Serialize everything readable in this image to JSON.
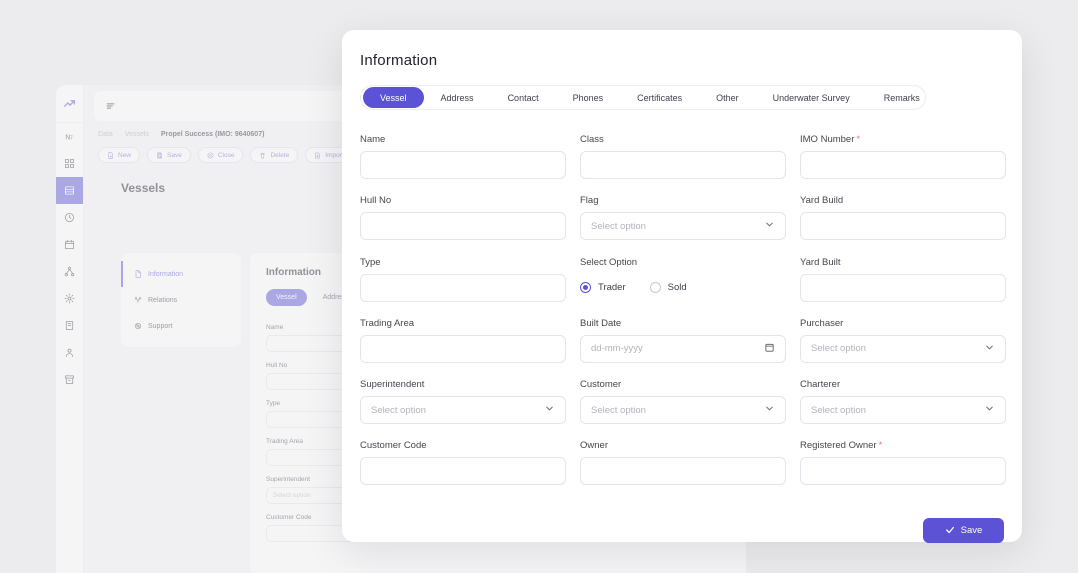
{
  "colors": {
    "accent": "#5b52d6",
    "required": "#f1737f",
    "page_bg": "#ececee"
  },
  "rail": {
    "logo_icon": "trending-up-icon",
    "items": [
      {
        "icon": "text-format-icon",
        "name": "rail-item-text-format",
        "active": false
      },
      {
        "icon": "grid-icon",
        "name": "rail-item-grid",
        "active": false
      },
      {
        "icon": "database-icon",
        "name": "rail-item-database",
        "active": true
      },
      {
        "icon": "clock-icon",
        "name": "rail-item-clock",
        "active": false
      },
      {
        "icon": "calendar-icon",
        "name": "rail-item-calendar",
        "active": false
      },
      {
        "icon": "hierarchy-icon",
        "name": "rail-item-hierarchy",
        "active": false
      },
      {
        "icon": "settings-icon",
        "name": "rail-item-settings",
        "active": false
      },
      {
        "icon": "report-icon",
        "name": "rail-item-report",
        "active": false
      },
      {
        "icon": "user-icon",
        "name": "rail-item-user",
        "active": false
      },
      {
        "icon": "archive-icon",
        "name": "rail-item-archive",
        "active": false
      }
    ]
  },
  "topbar": {
    "menu_icon": "menu-icon"
  },
  "breadcrumb": {
    "items": [
      "Data",
      "Vessels"
    ],
    "current": "Propel Success (IMO: 9640607)",
    "separator": "·"
  },
  "toolbar": {
    "buttons": [
      {
        "label": "New",
        "icon": "file-plus-icon"
      },
      {
        "label": "Save",
        "icon": "save-icon"
      },
      {
        "label": "Close",
        "icon": "close-circle-icon"
      },
      {
        "label": "Delete",
        "icon": "trash-icon"
      },
      {
        "label": "Import File",
        "icon": "import-icon"
      }
    ]
  },
  "page": {
    "title": "Vessels"
  },
  "subnav": {
    "items": [
      {
        "label": "Information",
        "icon": "document-icon",
        "active": true
      },
      {
        "label": "Relations",
        "icon": "relations-icon",
        "active": false
      },
      {
        "label": "Support",
        "icon": "support-icon",
        "active": false
      }
    ]
  },
  "background_form": {
    "title": "Information",
    "tabs": [
      {
        "label": "Vessel",
        "active": true
      },
      {
        "label": "Address",
        "active": false
      },
      {
        "label": "Contact",
        "active": false
      }
    ],
    "fields": [
      {
        "label": "Name",
        "value": "",
        "placeholder": "",
        "type": "text"
      },
      {
        "label": "Class",
        "value": "",
        "placeholder": "",
        "type": "text"
      },
      {
        "label": "IMO Number",
        "value": "",
        "placeholder": "",
        "type": "text",
        "required": true
      },
      {
        "label": "Hull No",
        "value": "",
        "placeholder": "",
        "type": "text"
      },
      {
        "label": "Flag",
        "value": "",
        "placeholder": "Select option",
        "type": "select"
      },
      {
        "label": "Yard Build",
        "value": "",
        "placeholder": "",
        "type": "text"
      },
      {
        "label": "Type",
        "value": "",
        "placeholder": "",
        "type": "text"
      },
      {
        "label": "Select Option",
        "value": "",
        "placeholder": "",
        "type": "text"
      },
      {
        "label": "Yard Built",
        "value": "",
        "placeholder": "",
        "type": "text"
      },
      {
        "label": "Trading Area",
        "value": "",
        "placeholder": "",
        "type": "text"
      },
      {
        "label": "Built Date",
        "value": "",
        "placeholder": "dd-mm-yyyy",
        "type": "date"
      },
      {
        "label": "Purchaser",
        "value": "",
        "placeholder": "Select option",
        "type": "select"
      },
      {
        "label": "Superintendent",
        "value": "",
        "placeholder": "Select option",
        "type": "select"
      },
      {
        "label": "Customer",
        "value": "",
        "placeholder": "Select option",
        "type": "select"
      },
      {
        "label": "Charterer",
        "value": "",
        "placeholder": "Select option",
        "type": "select"
      },
      {
        "label": "Customer Code",
        "value": "",
        "placeholder": "",
        "type": "text"
      },
      {
        "label": "Owner",
        "value": "",
        "placeholder": "",
        "type": "text"
      },
      {
        "label": "Registered Owner",
        "value": "",
        "placeholder": "",
        "type": "text",
        "required": true
      }
    ]
  },
  "modal": {
    "title": "Information",
    "tabs": [
      {
        "label": "Vessel",
        "active": true
      },
      {
        "label": "Address",
        "active": false
      },
      {
        "label": "Contact",
        "active": false
      },
      {
        "label": "Phones",
        "active": false
      },
      {
        "label": "Certificates",
        "active": false
      },
      {
        "label": "Other",
        "active": false
      },
      {
        "label": "Underwater Survey",
        "active": false
      },
      {
        "label": "Remarks",
        "active": false
      }
    ],
    "fields": [
      {
        "name": "name",
        "label": "Name",
        "value": "",
        "placeholder": "",
        "type": "text",
        "required": false
      },
      {
        "name": "class",
        "label": "Class",
        "value": "",
        "placeholder": "",
        "type": "text",
        "required": false
      },
      {
        "name": "imo-number",
        "label": "IMO Number",
        "value": "",
        "placeholder": "",
        "type": "text",
        "required": true
      },
      {
        "name": "hull-no",
        "label": "Hull No",
        "value": "",
        "placeholder": "",
        "type": "text",
        "required": false
      },
      {
        "name": "flag",
        "label": "Flag",
        "value": "",
        "placeholder": "Select option",
        "type": "select",
        "required": false
      },
      {
        "name": "yard-build",
        "label": "Yard Build",
        "value": "",
        "placeholder": "",
        "type": "text",
        "required": false
      },
      {
        "name": "type",
        "label": "Type",
        "value": "",
        "placeholder": "",
        "type": "text",
        "required": false
      },
      {
        "name": "select-option",
        "label": "Select Option",
        "value": "",
        "placeholder": "",
        "type": "radio",
        "required": false,
        "options": [
          {
            "label": "Trader",
            "selected": true
          },
          {
            "label": "Sold",
            "selected": false
          }
        ]
      },
      {
        "name": "yard-built",
        "label": "Yard Built",
        "value": "",
        "placeholder": "",
        "type": "text",
        "required": false
      },
      {
        "name": "trading-area",
        "label": "Trading Area",
        "value": "",
        "placeholder": "",
        "type": "text",
        "required": false
      },
      {
        "name": "built-date",
        "label": "Built Date",
        "value": "",
        "placeholder": "dd-mm-yyyy",
        "type": "date",
        "required": false
      },
      {
        "name": "purchaser",
        "label": "Purchaser",
        "value": "",
        "placeholder": "Select option",
        "type": "select",
        "required": false
      },
      {
        "name": "superintendent",
        "label": "Superintendent",
        "value": "",
        "placeholder": "Select option",
        "type": "select",
        "required": false
      },
      {
        "name": "customer",
        "label": "Customer",
        "value": "",
        "placeholder": "Select option",
        "type": "select",
        "required": false
      },
      {
        "name": "charterer",
        "label": "Charterer",
        "value": "",
        "placeholder": "Select option",
        "type": "select",
        "required": false
      },
      {
        "name": "customer-code",
        "label": "Customer Code",
        "value": "",
        "placeholder": "",
        "type": "text",
        "required": false
      },
      {
        "name": "owner",
        "label": "Owner",
        "value": "",
        "placeholder": "",
        "type": "text",
        "required": false
      },
      {
        "name": "registered-owner",
        "label": "Registered Owner",
        "value": "",
        "placeholder": "",
        "type": "text",
        "required": true
      }
    ],
    "save_button": {
      "label": "Save",
      "icon": "check-icon"
    }
  }
}
